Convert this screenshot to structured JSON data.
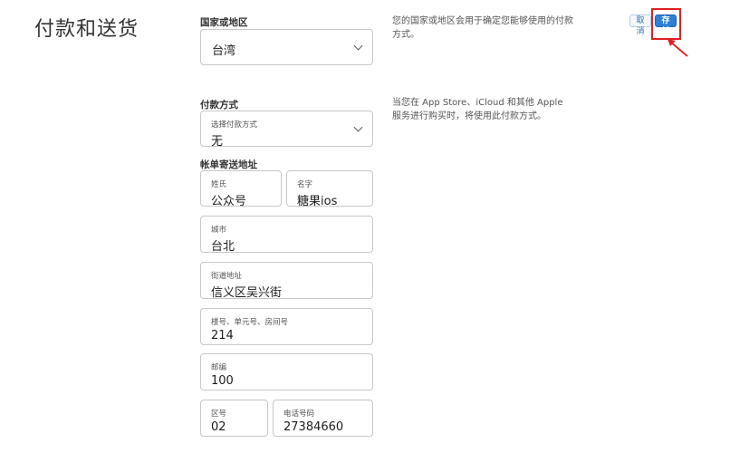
{
  "page": {
    "title": "付款和送货"
  },
  "country": {
    "section_label": "国家或地区",
    "value": "台湾",
    "help": "您的国家或地区会用于确定您能够使用的付款方式。"
  },
  "actions": {
    "cancel_label": "取消",
    "save_label": "存储"
  },
  "payment": {
    "section_label": "付款方式",
    "select_label": "选择付款方式",
    "value": "无",
    "help": "当您在 App Store、iCloud 和其他 Apple 服务进行购买时，将使用此付款方式。"
  },
  "billing": {
    "section_label": "帐单寄送地址",
    "last_name": {
      "label": "姓氏",
      "value": "公众号"
    },
    "first_name": {
      "label": "名字",
      "value": "糖果ios"
    },
    "city": {
      "label": "城市",
      "value": "台北"
    },
    "street": {
      "label": "街道地址",
      "value": "信义区吴兴街"
    },
    "unit": {
      "label": "楼号、单元号、房间号",
      "value": "214"
    },
    "postal": {
      "label": "邮编",
      "value": "100"
    },
    "area_code": {
      "label": "区号",
      "value": "02"
    },
    "phone": {
      "label": "电话号码",
      "value": "27384660"
    }
  },
  "colors": {
    "accent": "#2d7fd6",
    "annotation": "#e02020"
  }
}
